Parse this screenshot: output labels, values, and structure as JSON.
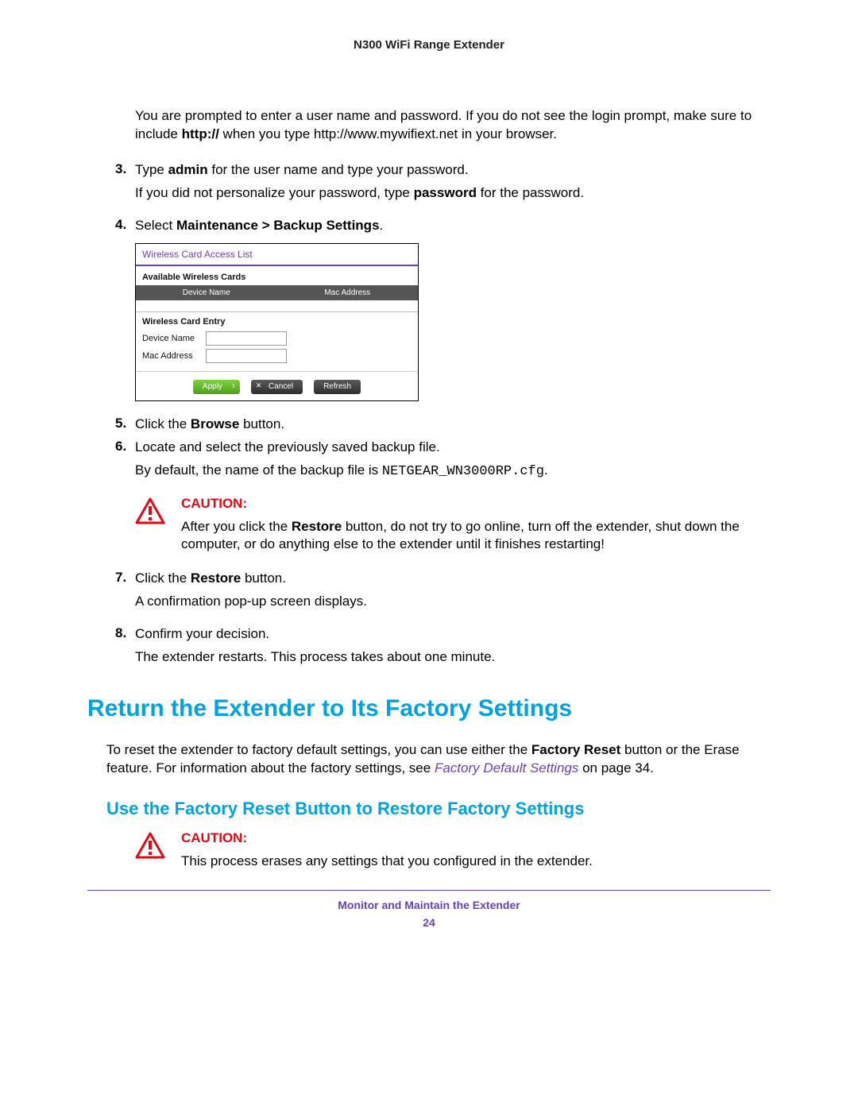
{
  "header": {
    "title": "N300 WiFi Range Extender"
  },
  "para": {
    "p1a": "You are prompted to enter a user name and password. If you do not see the login prompt, make sure to include ",
    "p1b": "http://",
    "p1c": " when you type http://www.mywifiext.net in your browser."
  },
  "steps": {
    "s3": {
      "num": "3.",
      "a": "Type ",
      "b": "admin",
      "c": " for the user name and type your password."
    },
    "s3f_a": "If you did not personalize your password, type ",
    "s3f_b": "password",
    "s3f_c": " for the password.",
    "s4": {
      "num": "4.",
      "a": "Select ",
      "b": "Maintenance > Backup Settings",
      "c": "."
    },
    "s5": {
      "num": "5.",
      "a": "Click the ",
      "b": "Browse",
      "c": " button."
    },
    "s6": {
      "num": "6.",
      "a": "Locate and select the previously saved backup file."
    },
    "s6f_a": "By default, the name of the backup file is ",
    "s6f_code": "NETGEAR_WN3000RP.cfg",
    "s6f_c": ".",
    "s7": {
      "num": "7.",
      "a": "Click the ",
      "b": "Restore",
      "c": " button."
    },
    "s7f": "A confirmation pop-up screen displays.",
    "s8": {
      "num": "8.",
      "a": "Confirm your decision."
    },
    "s8f": "The extender restarts. This process takes about one minute."
  },
  "ui": {
    "title": "Wireless Card Access List",
    "available": "Available Wireless Cards",
    "col1": "Device Name",
    "col2": "Mac Address",
    "entry": "Wireless Card Entry",
    "lbl_device": "Device Name",
    "lbl_mac": "Mac Address",
    "btn_apply": "Apply",
    "btn_cancel": "Cancel",
    "btn_refresh": "Refresh"
  },
  "caution1": {
    "label": "CAUTION:",
    "a": "After you click the ",
    "b": "Restore",
    "c": " button, do not try to go online, turn off the extender, shut down the computer, or do anything else to the extender until it finishes restarting!"
  },
  "h1": "Return the Extender to Its Factory Settings",
  "para2": {
    "a": "To reset the extender to factory default settings, you can use either the ",
    "b": "Factory Reset",
    "c": " button or the Erase feature. For information about the factory settings, see ",
    "link": "Factory Default Settings",
    "d": " on page 34."
  },
  "h2": "Use the Factory Reset Button to Restore Factory Settings",
  "caution2": {
    "label": "CAUTION:",
    "text": "This process erases any settings that you configured in the extender."
  },
  "footer": {
    "section": "Monitor and Maintain the Extender",
    "page": "24"
  }
}
